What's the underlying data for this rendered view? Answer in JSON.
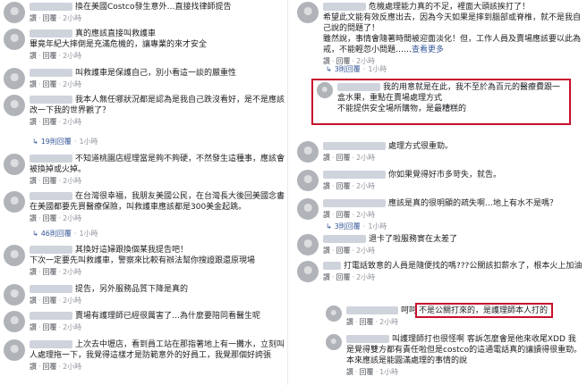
{
  "ui": {
    "reply_label": "回覆",
    "like_label": "讚",
    "sep": "·",
    "replies_suffix": "則回覆",
    "see_more": "查看更多"
  },
  "left": [
    {
      "text": "換在美國Costco發生意外…直接找律師提告",
      "meta_time": "2小時"
    },
    {
      "text": "真的應該直接叫救護車\n畢竟年紀大摔倒是充滿危機的，讓專業的來才安全",
      "meta_time": "2小時"
    },
    {
      "text": "叫救護車是保護自己，別小看這一談的嚴重性",
      "meta_time": "2小時"
    },
    {
      "text": "我本人無任哪狀況都是認為是我自己跌沒看好，是不是應該改一下我的世界觀了？",
      "meta_time": "2小時",
      "reply_count": "19",
      "reply_time": "1小時"
    },
    {
      "text": "不知道桃園店經理當是夠不夠硬，不然發生這種事，應該會被換掉或火掉。",
      "meta_time": "2小時"
    },
    {
      "text": "在台灣很幸福，我朋友美國公民，在台灣長大後回美國念書在美國都要先買醫療保險，叫救護車應該都是300美金起跳。",
      "meta_time": "2小時",
      "reply_count": "46",
      "reply_time": "1小時"
    },
    {
      "text": "其換好這婦跟換個某我提告吧！\n下次一定要先叫救護車，警察來比較有辦法幫你搜證跟還原現場",
      "meta_time": "2小時"
    },
    {
      "text": "提告，另外服務品質下降是真的",
      "meta_time": "2小時"
    },
    {
      "text": "賣場有護理師已經很厲害了…為什麼要陪同看醫生呢",
      "meta_time": "2小時"
    },
    {
      "text": "上次去中壢店，看到員工站在那指著地上有一攤水，立刻叫人處理拖一下，我覺得這樣才是防範意外的好員工，我覺那個好誇張",
      "meta_time": "2小時"
    }
  ],
  "right": [
    {
      "text": "危機處理能力真的不足，裡面大頭該挨打了！\n希望此文能有效反應出去，因為今天如果是摔到腦部或脊椎，就不是我自己說的問題了！\n雖然說，事情會隨著時間被迎面淡化！但，工作人員及賣場應該要以此為戒，不能輕忽小問題……",
      "meta_time": "2小時",
      "see_more": true,
      "reply_count": "3",
      "reply_time": "1小時"
    },
    {
      "text": "我的用意就是在此，我不至於為百元的醫療費跟一盒水果，重點在賣場處理方式\n不能提供安全場所購物，是最糟糕的",
      "meta_time": "2小時",
      "highlight": true
    },
    {
      "text": "處理方式很重勁。",
      "meta_time": "2小時"
    },
    {
      "text": "你如果覺得好市多苛失，就告。",
      "meta_time": "2小時"
    },
    {
      "text": "應該是真的很明顯的疏失啊…地上有水不是嗎？",
      "meta_time": "2小時",
      "reply_count": "3",
      "reply_time": "1小時"
    },
    {
      "text": "退卡了啦服務實在太差了",
      "meta_time": "2小時"
    },
    {
      "text": "打電話致意的人員是隨便找的嗎???公關該扣薪水了，根本火上加油",
      "meta_time": "2小時"
    },
    {
      "text": "呵呵",
      "quote": "不是公關打來的，是護理師本人打的",
      "meta_time": "2小時",
      "reply": true
    },
    {
      "text": "叫護理師打也很怪啊 客訴怎麼會是他來收尾XDD 我是覺得雙方都有責任啦但是costco的這通電話真的讓讀得很重勁。本來應該是能圓滿處理的事情的說",
      "meta_time": "1小時",
      "reply": true
    }
  ]
}
